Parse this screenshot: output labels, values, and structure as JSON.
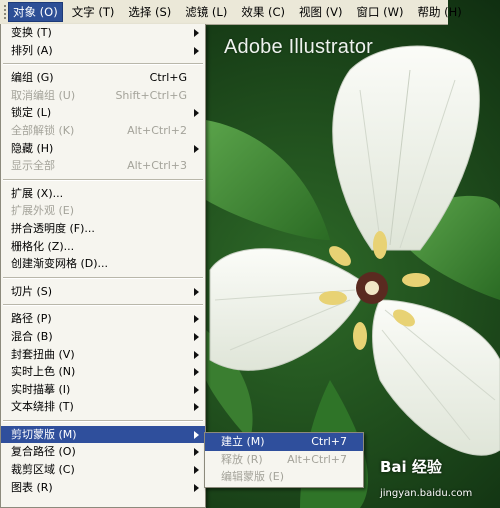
{
  "app": {
    "title": "Adobe Illustrator"
  },
  "watermark": {
    "text": "Bai 经验",
    "sub": "jingyan.baidu.com"
  },
  "menubar": [
    {
      "label": "对象 (O)",
      "active": true
    },
    {
      "label": "文字 (T)"
    },
    {
      "label": "选择 (S)"
    },
    {
      "label": "滤镜 (L)"
    },
    {
      "label": "效果 (C)"
    },
    {
      "label": "视图 (V)"
    },
    {
      "label": "窗口 (W)"
    },
    {
      "label": "帮助 (H)"
    }
  ],
  "menu": {
    "transform": "变换 (T)",
    "arrange": "排列 (A)",
    "group": "编组 (G)",
    "group_sc": "Ctrl+G",
    "ungroup": "取消编组 (U)",
    "ungroup_sc": "Shift+Ctrl+G",
    "lock": "锁定 (L)",
    "unlock_all": "全部解锁 (K)",
    "unlock_all_sc": "Alt+Ctrl+2",
    "hide": "隐藏 (H)",
    "show_all": "显示全部",
    "show_all_sc": "Alt+Ctrl+3",
    "expand": "扩展 (X)...",
    "expand_appearance": "扩展外观 (E)",
    "flatten_transparency": "拼合透明度 (F)...",
    "rasterize": "栅格化 (Z)...",
    "gradient_mesh": "创建渐变网格 (D)...",
    "slice": "切片 (S)",
    "path": "路径 (P)",
    "blend": "混合 (B)",
    "envelope_distort": "封套扭曲 (V)",
    "live_paint": "实时上色 (N)",
    "live_trace": "实时描摹 (I)",
    "text_wrap": "文本绕排 (T)",
    "clipping_mask": "剪切蒙版 (M)",
    "compound_path": "复合路径 (O)",
    "crop_area": "裁剪区域 (C)",
    "graph": "图表 (R)"
  },
  "submenu": {
    "make": "建立 (M)",
    "make_sc": "Ctrl+7",
    "release": "释放 (R)",
    "release_sc": "Alt+Ctrl+7",
    "edit_mask": "编辑蒙版 (E)"
  },
  "colors": {
    "highlight": "#2f4f9c",
    "menu_bg": "#f6f5ef",
    "menubar_bg": "#ebe8d8",
    "leaf_green": "#3f8a36"
  }
}
